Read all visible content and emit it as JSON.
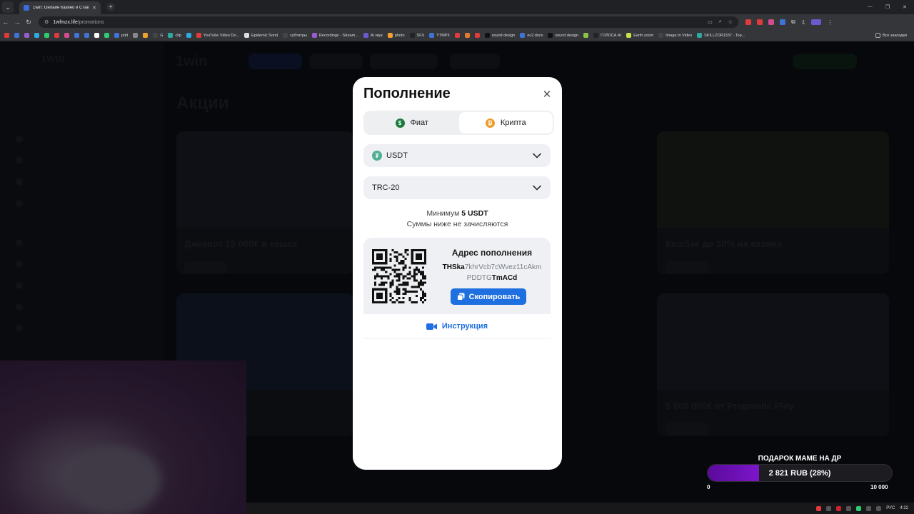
{
  "browser": {
    "tab_title": "1win: Онлайн Казино и Ставк...",
    "url_host": "1wfmzx.life",
    "url_path": "/promotions",
    "bookmarks": [
      {
        "label": "",
        "color": "#e03a3a"
      },
      {
        "label": "",
        "color": "#3f73d8"
      },
      {
        "label": "",
        "color": "#9b59d0"
      },
      {
        "label": "",
        "color": "#2fa9e0"
      },
      {
        "label": "",
        "color": "#2ecc71"
      },
      {
        "label": "",
        "color": "#e03a3a"
      },
      {
        "label": "",
        "color": "#d64b8e"
      },
      {
        "label": "",
        "color": "#3f73d8"
      },
      {
        "label": "",
        "color": "#3f73d8"
      },
      {
        "label": "",
        "color": "#ffffff"
      },
      {
        "label": "",
        "color": "#2ecc71"
      },
      {
        "label": "pdd",
        "color": "#3f73d8"
      },
      {
        "label": "",
        "color": "#888888"
      },
      {
        "label": "",
        "color": "#f0a030"
      },
      {
        "label": "G",
        "color": "#444444"
      },
      {
        "label": "clip",
        "color": "#2fa9a0"
      },
      {
        "label": "",
        "color": "#2fa9e0"
      },
      {
        "label": "YouTube Video Do...",
        "color": "#e03a3a"
      },
      {
        "label": "Epidemic Sond",
        "color": "#dddddd"
      },
      {
        "label": "субтитры",
        "color": "#444444"
      },
      {
        "label": "Recordings - Stream...",
        "color": "#9b59d0"
      },
      {
        "label": "Ai звук",
        "color": "#6a5acd"
      },
      {
        "label": "photo",
        "color": "#f0a030"
      },
      {
        "label": "SFX",
        "color": "#222222"
      },
      {
        "label": "YTMP3",
        "color": "#3f73d8"
      },
      {
        "label": "",
        "color": "#e03a3a"
      },
      {
        "label": "",
        "color": "#e07a30"
      },
      {
        "label": "",
        "color": "#e03a3a"
      },
      {
        "label": "sound design",
        "color": "#111111"
      },
      {
        "label": "ec2.docs",
        "color": "#3f73d8"
      },
      {
        "label": "sound design",
        "color": "#111111"
      },
      {
        "label": "",
        "color": "#8bc34a"
      },
      {
        "label": "ГОЛОСА AI",
        "color": "#222222"
      },
      {
        "label": "Earth zoom",
        "color": "#c5e04a"
      },
      {
        "label": "Image to Video",
        "color": "#444444"
      },
      {
        "label": "SKILLZOR1337 - Top...",
        "color": "#2fa9a0"
      }
    ],
    "all_bookmarks_label": "Все закладки"
  },
  "modal": {
    "title": "Пополнение",
    "tabs": [
      {
        "label": "Фиат",
        "icon": "$",
        "active": false
      },
      {
        "label": "Крипта",
        "icon": "₿",
        "active": true
      }
    ],
    "currency": "USDT",
    "network": "TRC-20",
    "minimum_prefix": "Минимум",
    "minimum_value": "5 USDT",
    "note": "Суммы ниже не зачисляются",
    "address_title": "Адрес пополнения",
    "address_start_bold": "THSka",
    "address_middle_1": "7khrVcb7cWvez11cAkm",
    "address_middle_2": "PDDTG",
    "address_end_bold": "TmACd",
    "copy_label": "Скопировать",
    "instruction_label": "Инструкция"
  },
  "background_site": {
    "page_title": "Акции",
    "cards": [
      "Джекпот 15 000€ в кешах",
      "Кешбэк до 30% на казино",
      "",
      "5 000 000€ от Pragmatic Play"
    ]
  },
  "donation": {
    "title": "ПОДАРОК МАМЕ НА ДР",
    "progress_text": "2 821 RUB (28%)",
    "progress_fraction": 0.28,
    "min_label": "0",
    "max_label": "10 000"
  },
  "taskbar": {
    "lang": "РУС",
    "time": "4:22"
  },
  "colors": {
    "accent_blue": "#1e6fe0",
    "tether_green": "#50af95",
    "fiat_green": "#1b7a3e",
    "crypto_orange": "#ee9b2a",
    "donate_purple": "#6a10b8"
  }
}
